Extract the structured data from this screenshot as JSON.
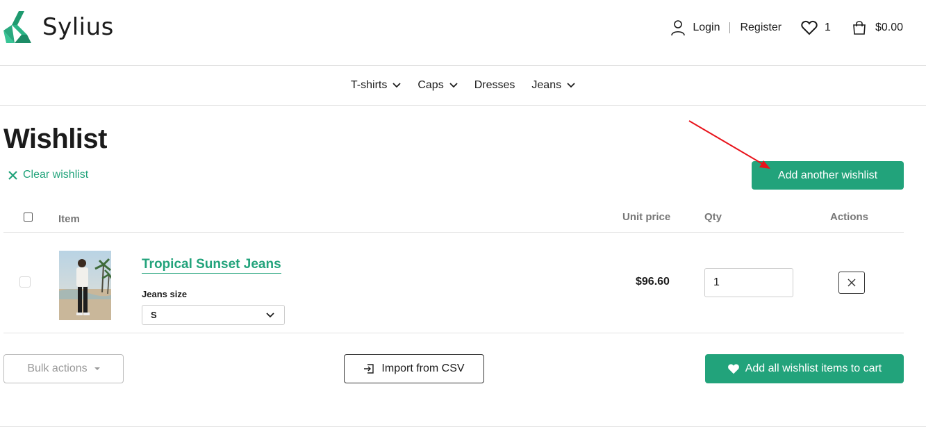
{
  "brand": {
    "name": "Sylius",
    "accent": "#22a37b"
  },
  "header": {
    "login_label": "Login",
    "register_label": "Register",
    "wishlist_count": "1",
    "cart_total": "$0.00"
  },
  "nav": {
    "items": [
      {
        "label": "T-shirts",
        "has_dropdown": true
      },
      {
        "label": "Caps",
        "has_dropdown": true
      },
      {
        "label": "Dresses",
        "has_dropdown": false
      },
      {
        "label": "Jeans",
        "has_dropdown": true
      }
    ]
  },
  "page": {
    "title": "Wishlist",
    "clear_label": "Clear wishlist",
    "add_wishlist_label": "Add another wishlist"
  },
  "table": {
    "headers": {
      "item": "Item",
      "unit_price": "Unit price",
      "qty": "Qty",
      "actions": "Actions"
    },
    "rows": [
      {
        "name": "Tropical Sunset Jeans",
        "option_label": "Jeans size",
        "option_value": "S",
        "unit_price": "$96.60",
        "qty": "1"
      }
    ]
  },
  "footer_actions": {
    "bulk_label": "Bulk actions",
    "import_label": "Import from CSV",
    "add_all_label": "Add all wishlist items to cart"
  }
}
